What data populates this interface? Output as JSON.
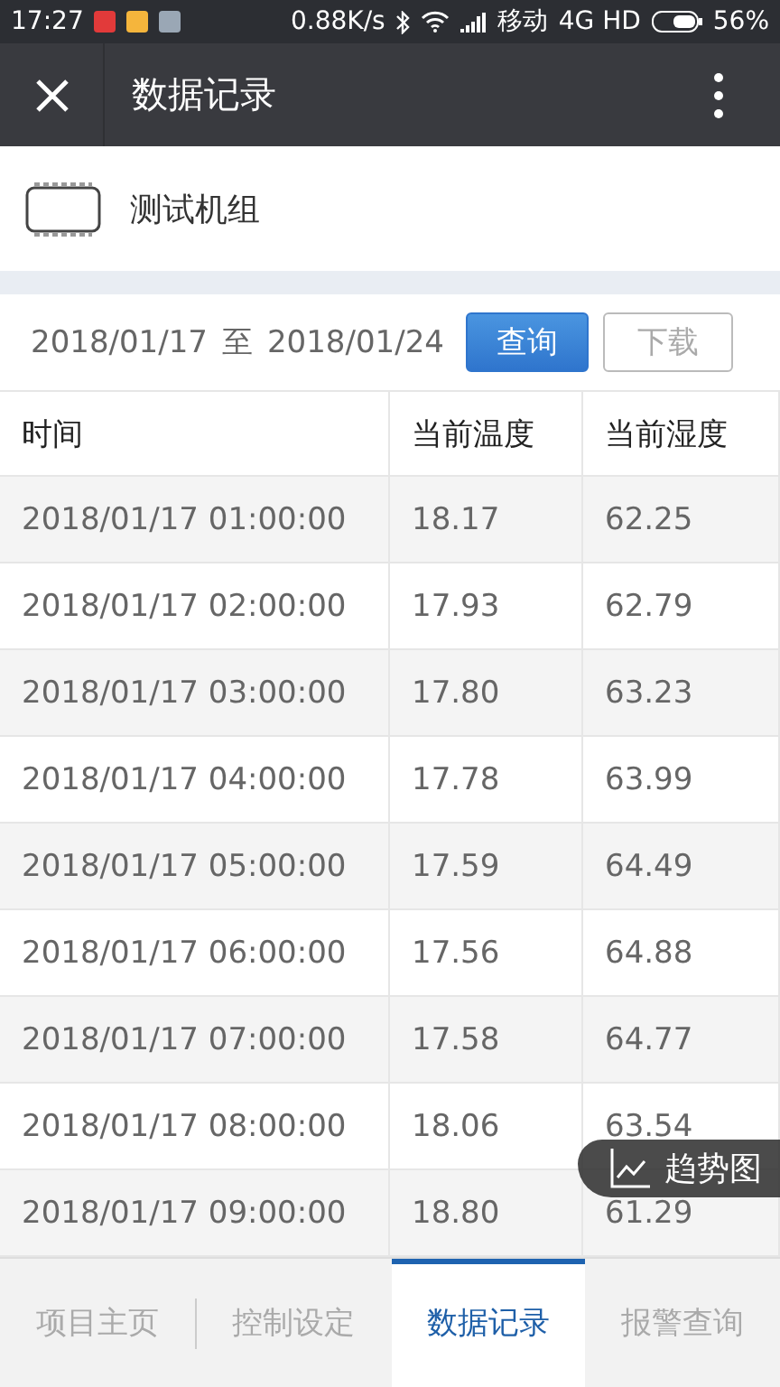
{
  "status_bar": {
    "time": "17:27",
    "speed": "0.88K/s",
    "carrier": "移动",
    "network": "4G HD",
    "battery": "56%"
  },
  "header": {
    "title": "数据记录"
  },
  "device": {
    "name": "测试机组"
  },
  "query": {
    "start": "2018/01/17",
    "separator": "至",
    "end": "2018/01/24",
    "buttons": [
      {
        "label": "查询",
        "kind": "primary"
      },
      {
        "label": "下载",
        "kind": "outline"
      }
    ]
  },
  "table": {
    "columns": [
      "时间",
      "当前温度",
      "当前湿度"
    ],
    "rows": [
      [
        "2018/01/17 01:00:00",
        "18.17",
        "62.25"
      ],
      [
        "2018/01/17 02:00:00",
        "17.93",
        "62.79"
      ],
      [
        "2018/01/17 03:00:00",
        "17.80",
        "63.23"
      ],
      [
        "2018/01/17 04:00:00",
        "17.78",
        "63.99"
      ],
      [
        "2018/01/17 05:00:00",
        "17.59",
        "64.49"
      ],
      [
        "2018/01/17 06:00:00",
        "17.56",
        "64.88"
      ],
      [
        "2018/01/17 07:00:00",
        "17.58",
        "64.77"
      ],
      [
        "2018/01/17 08:00:00",
        "18.06",
        "63.54"
      ],
      [
        "2018/01/17 09:00:00",
        "18.80",
        "61.29"
      ]
    ]
  },
  "trend_button": {
    "label": "趋势图"
  },
  "tabs": [
    {
      "label": "项目主页",
      "selected": false
    },
    {
      "label": "控制设定",
      "selected": false
    },
    {
      "label": "数据记录",
      "selected": true
    },
    {
      "label": "报警查询",
      "selected": false
    }
  ]
}
